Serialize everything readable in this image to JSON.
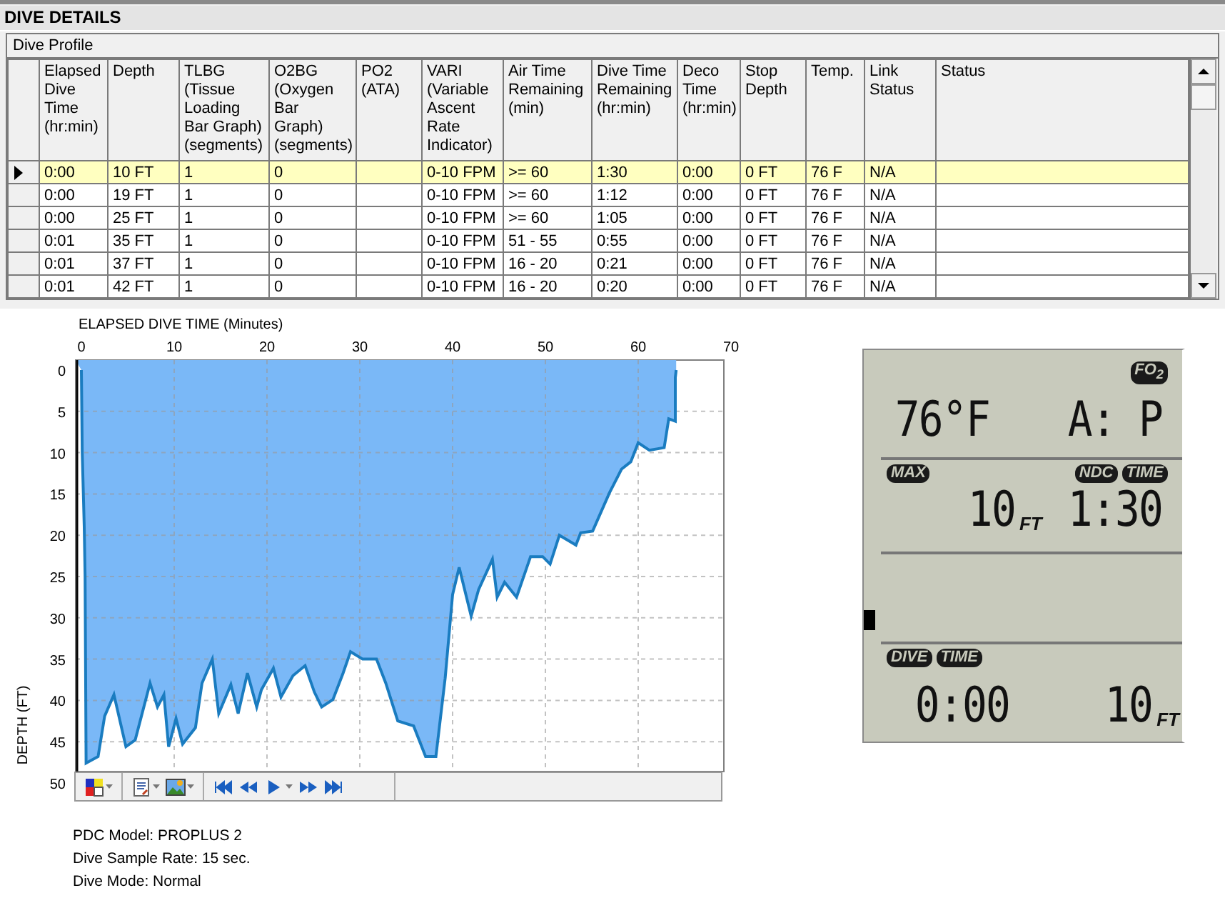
{
  "panel": {
    "title": "DIVE DETAILS"
  },
  "dive_profile": {
    "title": "Dive Profile",
    "table": {
      "columns": [
        "Elapsed Dive Time (hr:min)",
        "Depth",
        "TLBG (Tissue Loading Bar Graph) (segments)",
        "O2BG (Oxygen Bar Graph) (segments)",
        "PO2 (ATA)",
        "VARI (Variable Ascent Rate Indicator)",
        "Air Time Remaining (min)",
        "Dive Time Remaining (hr:min)",
        "Deco Time (hr:min)",
        "Stop Depth",
        "Temp.",
        "Link Status",
        "Status"
      ],
      "rows": [
        {
          "selected": true,
          "cells": [
            "0:00",
            "10 FT",
            "1",
            "0",
            "",
            "0-10 FPM",
            ">= 60",
            "1:30",
            "0:00",
            "0 FT",
            "76 F",
            "N/A",
            ""
          ]
        },
        {
          "selected": false,
          "cells": [
            "0:00",
            "19 FT",
            "1",
            "0",
            "",
            "0-10 FPM",
            ">= 60",
            "1:12",
            "0:00",
            "0 FT",
            "76 F",
            "N/A",
            ""
          ]
        },
        {
          "selected": false,
          "cells": [
            "0:00",
            "25 FT",
            "1",
            "0",
            "",
            "0-10 FPM",
            ">= 60",
            "1:05",
            "0:00",
            "0 FT",
            "76 F",
            "N/A",
            ""
          ]
        },
        {
          "selected": false,
          "cells": [
            "0:01",
            "35 FT",
            "1",
            "0",
            "",
            "0-10 FPM",
            "51 - 55",
            "0:55",
            "0:00",
            "0 FT",
            "76 F",
            "N/A",
            ""
          ]
        },
        {
          "selected": false,
          "cells": [
            "0:01",
            "37 FT",
            "1",
            "0",
            "",
            "0-10 FPM",
            "16 - 20",
            "0:21",
            "0:00",
            "0 FT",
            "76 F",
            "N/A",
            ""
          ]
        },
        {
          "selected": false,
          "cells": [
            "0:01",
            "42 FT",
            "1",
            "0",
            "",
            "0-10 FPM",
            "16 - 20",
            "0:20",
            "0:00",
            "0 FT",
            "76 F",
            "N/A",
            ""
          ]
        }
      ]
    }
  },
  "chart": {
    "chart_data": {
      "type": "area",
      "title": "ELAPSED DIVE TIME (Minutes)",
      "ylabel": "DEPTH (FT)",
      "grid": true,
      "xlim": [
        0,
        70
      ],
      "ylim": [
        50,
        0
      ],
      "xticks": [
        0,
        10,
        20,
        30,
        40,
        50,
        60,
        70
      ],
      "yticks": [
        0,
        5,
        10,
        15,
        20,
        25,
        30,
        35,
        40,
        45,
        50
      ],
      "x": [
        0,
        0.1,
        0.3,
        0.4,
        0.5,
        1.8,
        2.5,
        3.5,
        4.8,
        5.8,
        7.4,
        8.2,
        8.9,
        9.4,
        10.2,
        10.9,
        12.3,
        13,
        14.1,
        14.8,
        16.1,
        16.9,
        17.9,
        18.9,
        19.4,
        20.7,
        21.5,
        22.8,
        24.1,
        25.1,
        25.9,
        27.1,
        28.2,
        29,
        30.3,
        31.8,
        32.8,
        34.1,
        35.8,
        37.1,
        38.2,
        39.2,
        40,
        40.7,
        42,
        42.8,
        44.3,
        44.8,
        45.6,
        46.9,
        48.4,
        49.7,
        50.5,
        51.5,
        53.3,
        53.8,
        55.1,
        56.9,
        58.2,
        59.2,
        60,
        61.2,
        62.8,
        63.3,
        64,
        64,
        64.1
      ],
      "series": [
        {
          "color": "#1a7cc0",
          "values": [
            0,
            10,
            19,
            25,
            47.6,
            46.8,
            41.9,
            39.3,
            45.6,
            44.8,
            37.9,
            40.8,
            39.3,
            45.6,
            42.2,
            45.3,
            43.3,
            37.9,
            35,
            41.6,
            38.1,
            41.6,
            36.7,
            40.8,
            38.7,
            36.1,
            39.6,
            37,
            35.8,
            39,
            40.8,
            39.9,
            36.7,
            34.1,
            35,
            35,
            37.9,
            42.5,
            43.1,
            46.8,
            46.8,
            37.3,
            27.2,
            23.9,
            29.8,
            26.6,
            22.9,
            27.5,
            25.7,
            27.5,
            22.6,
            22.6,
            23.5,
            20,
            21.2,
            19.7,
            19.5,
            14.9,
            12,
            11.1,
            8.8,
            9.7,
            9.4,
            5.9,
            6.2,
            0.9,
            0
          ]
        }
      ]
    }
  },
  "toolbar": {
    "buttons": [
      {
        "kind": "colors",
        "dropdown": true
      },
      {
        "kind": "report",
        "dropdown": true
      },
      {
        "kind": "image",
        "dropdown": true
      },
      {
        "kind": "first",
        "dropdown": false
      },
      {
        "kind": "rewind",
        "dropdown": false
      },
      {
        "kind": "play",
        "dropdown": true
      },
      {
        "kind": "forward",
        "dropdown": false
      },
      {
        "kind": "last",
        "dropdown": false
      }
    ]
  },
  "info": [
    "PDC Model: PROPLUS 2",
    "Dive Sample Rate: 15 sec.",
    "Dive Mode: Normal"
  ],
  "lcd": {
    "fo2_label": "FO$_{2}$",
    "temperature": "76°F",
    "mode": "A: P",
    "max_label": "MAX",
    "max_depth": "10",
    "max_depth_unit": "FT",
    "ndc_label": "NDC",
    "ndc_time_label": "TIME",
    "ndc_time": "1:30",
    "dive_label": "DIVE",
    "dive_time_label": "TIME",
    "dive_time": "0:00",
    "depth": "10",
    "depth_unit": "FT"
  }
}
